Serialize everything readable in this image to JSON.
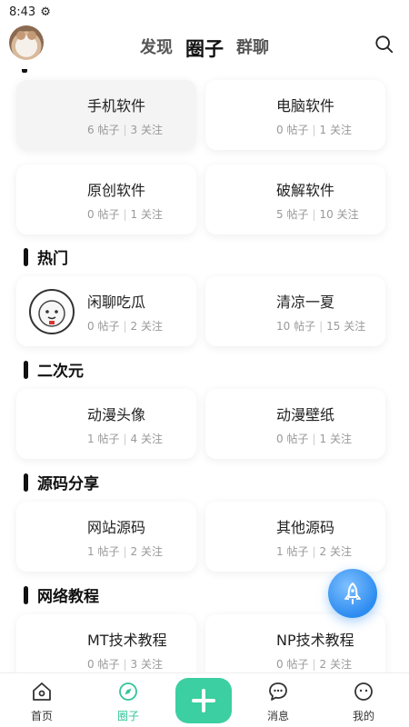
{
  "status": {
    "time": "8:43"
  },
  "header": {
    "tabs": [
      {
        "label": "发现"
      },
      {
        "label": "圈子"
      },
      {
        "label": "群聊"
      }
    ]
  },
  "groups": [
    {
      "cards": [
        {
          "title": "手机软件",
          "posts": "6 帖子",
          "follows": "3 关注"
        },
        {
          "title": "电脑软件",
          "posts": "0 帖子",
          "follows": "1 关注"
        },
        {
          "title": "原创软件",
          "posts": "0 帖子",
          "follows": "1 关注"
        },
        {
          "title": "破解软件",
          "posts": "5 帖子",
          "follows": "10 关注"
        }
      ]
    },
    {
      "heading": "热门",
      "cards": [
        {
          "title": "闲聊吃瓜",
          "posts": "0 帖子",
          "follows": "2 关注"
        },
        {
          "title": "清凉一夏",
          "posts": "10 帖子",
          "follows": "15 关注"
        }
      ]
    },
    {
      "heading": "二次元",
      "cards": [
        {
          "title": "动漫头像",
          "posts": "1 帖子",
          "follows": "4 关注"
        },
        {
          "title": "动漫壁纸",
          "posts": "0 帖子",
          "follows": "1 关注"
        }
      ]
    },
    {
      "heading": "源码分享",
      "cards": [
        {
          "title": "网站源码",
          "posts": "1 帖子",
          "follows": "2 关注"
        },
        {
          "title": "其他源码",
          "posts": "1 帖子",
          "follows": "2 关注"
        }
      ]
    },
    {
      "heading": "网络教程",
      "cards": [
        {
          "title": "MT技术教程",
          "posts": "0 帖子",
          "follows": "3 关注"
        },
        {
          "title": "NP技术教程",
          "posts": "0 帖子",
          "follows": "2 关注"
        }
      ]
    }
  ],
  "bottom_nav": [
    {
      "label": "首页"
    },
    {
      "label": "圈子"
    },
    {
      "label": "消息"
    },
    {
      "label": "我的"
    }
  ],
  "colors": {
    "accent": "#3ccfa1",
    "fab": "#2d8cf0"
  }
}
